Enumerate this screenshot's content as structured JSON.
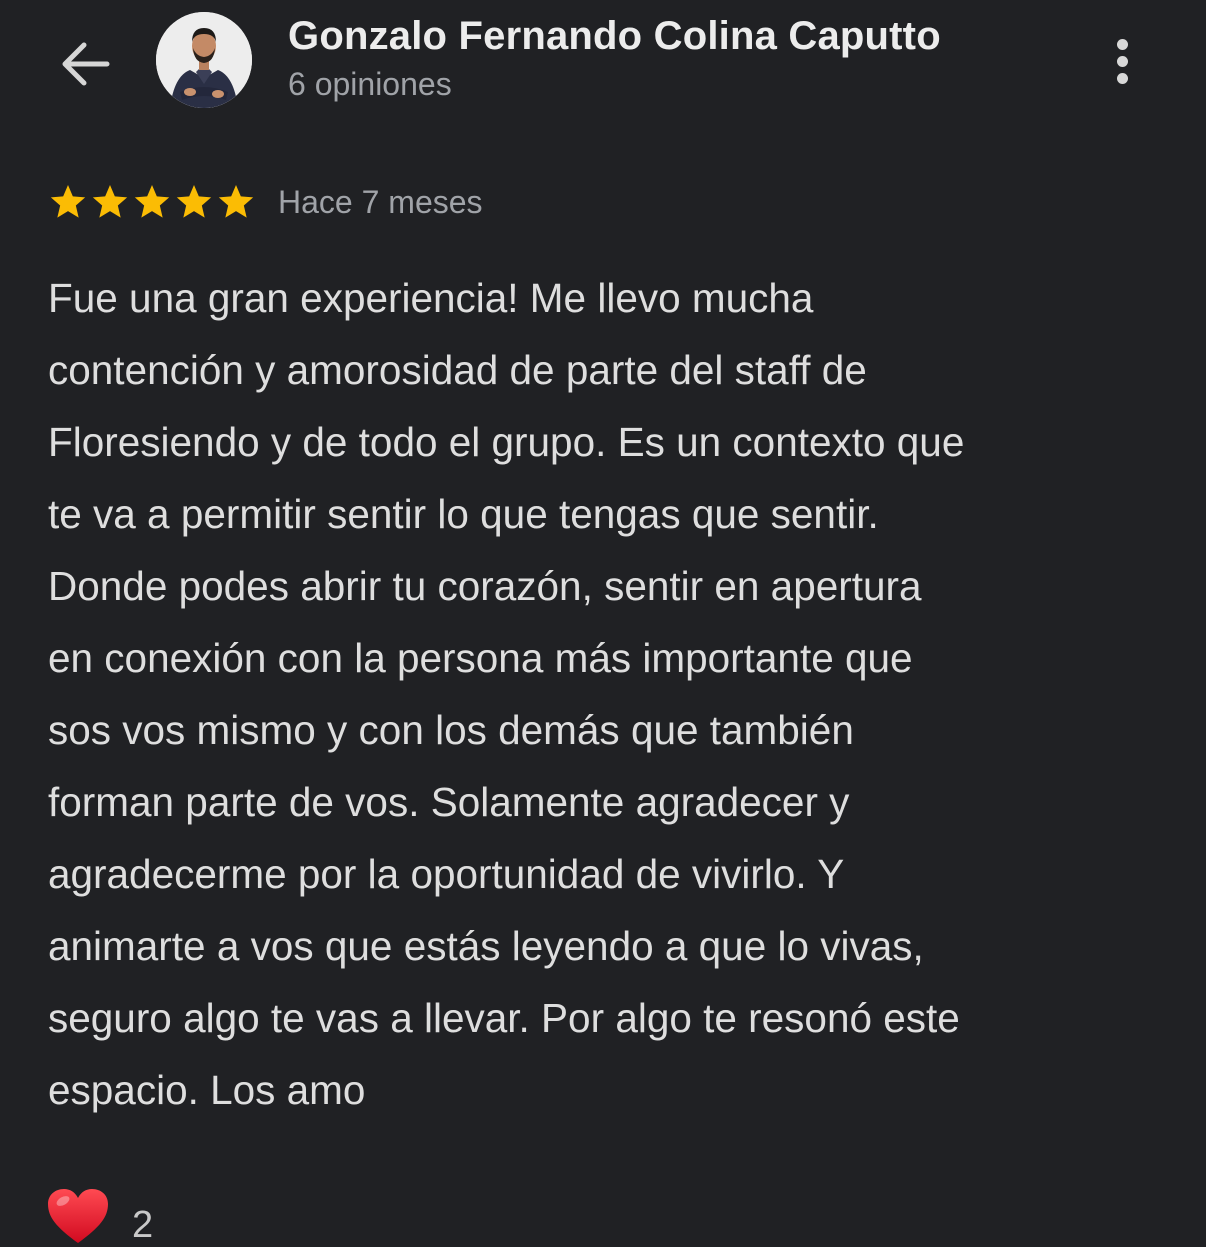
{
  "header": {
    "reviewer_name": "Gonzalo Fernando Colina Caputto",
    "review_count": "6 opiniones",
    "back_icon": "arrow-left-icon",
    "more_icon": "more-vertical-icon"
  },
  "review": {
    "rating": 5,
    "rating_max": 5,
    "date": "Hace 7 meses",
    "lines": [
      "Fue una gran experiencia! Me llevo mucha",
      "contención y amorosidad de parte del staff de",
      "Floresiendo y de todo el grupo. Es un contexto que",
      "te va a permitir sentir lo que tengas que sentir.",
      "Donde podes abrir tu corazón, sentir en apertura",
      "en conexión con la persona más importante que",
      "sos vos mismo y con los demás que también",
      "forman parte de vos. Solamente agradecer y",
      "agradecerme por la oportunidad de vivirlo. Y",
      "animarte a vos que estás leyendo a que lo vivas,",
      "seguro algo te vas a llevar. Por algo te resonó este",
      "espacio. Los amo"
    ]
  },
  "reactions": {
    "icon": "heart-icon",
    "count": "2"
  },
  "colors": {
    "background": "#202124",
    "star": "#fbbc04",
    "heart": "#e0102a",
    "text": "#dedede",
    "secondary_text": "#a0a3a8"
  }
}
